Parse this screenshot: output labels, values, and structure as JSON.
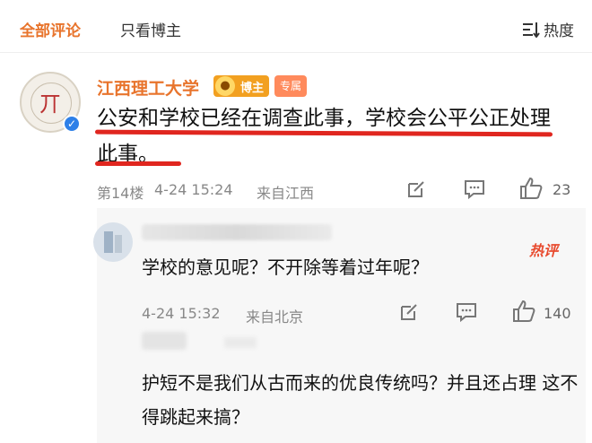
{
  "tabs": {
    "all": "全部评论",
    "blogger_only": "只看博主",
    "sort": "热度"
  },
  "comment": {
    "author": "江西理工大学",
    "badge_blogger": "博主",
    "badge_special": "专属",
    "avatar_glyph": "丌",
    "text": "公安和学校已经在调查此事，学校会公平公正处理此事。",
    "floor": "第14楼",
    "time": "4-24 15:24",
    "location": "来自江西",
    "likes": "23"
  },
  "reply1": {
    "text": "学校的意见呢？不开除等着过年呢？",
    "hot_label": "热评",
    "time": "4-24 15:32",
    "location": "来自北京",
    "likes": "140"
  },
  "reply2": {
    "text": "护短不是我们从古而来的优良传统吗？并且还占理  这不得跳起来搞？"
  },
  "colors": {
    "accent": "#e8742c",
    "underline": "#e0261f",
    "verified": "#2e80e8"
  }
}
